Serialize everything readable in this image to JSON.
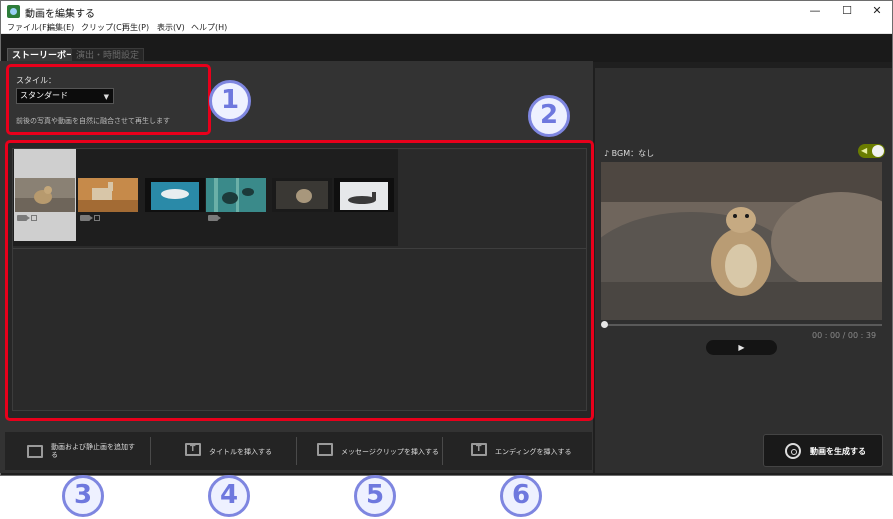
{
  "window": {
    "title": "動画を編集する",
    "minimize_glyph": "—",
    "maximize_glyph": "☐",
    "close_glyph": "✕"
  },
  "menu": [
    "ファイル(F)",
    "編集(E)",
    "クリップ(C)",
    "再生(P)",
    "表示(V)",
    "ヘルプ(H)"
  ],
  "tabs": {
    "storyboard": "ストーリーボード",
    "effects": "演出・時間設定"
  },
  "style_panel": {
    "label": "スタイル：",
    "selected": "スタンダード",
    "description": "前後の写真や動画を自然に融合させて再生します"
  },
  "callouts": [
    "1",
    "2",
    "3",
    "4",
    "5",
    "6"
  ],
  "preview": {
    "bgm_label": "BGM：なし",
    "bgm_enabled": true,
    "timecode": "00 : 00 / 00 : 39",
    "play_glyph": "▶",
    "playback_progress": 0.0
  },
  "toolbar": {
    "add_media": "動画および静止画を追加する",
    "insert_title": "タイトルを挿入する",
    "insert_message": "メッセージクリップを挿入する",
    "insert_ending": "エンディングを挿入する",
    "generate": "動画を生成する"
  },
  "icons": {
    "app": "app-icon",
    "music": "music-note-icon",
    "speaker": "speaker-icon",
    "video_clip": "video-clip-icon",
    "film_reel": "film-reel-icon"
  },
  "colors": {
    "highlight": "#e8001b",
    "callout": "#6e78de",
    "toggle_on": "#6a7d00"
  }
}
